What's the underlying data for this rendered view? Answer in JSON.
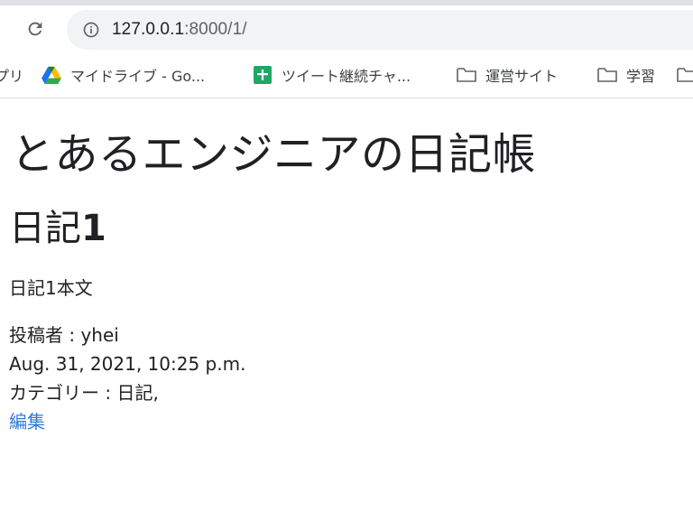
{
  "browser": {
    "url_host": "127.0.0.1",
    "url_path": ":8000/1/",
    "bookmarks": [
      {
        "label": "アプリ",
        "icon": "apps-icon"
      },
      {
        "label": "マイドライブ - Go...",
        "icon": "google-drive-icon"
      },
      {
        "label": "ツイート継続チャ...",
        "icon": "google-sheets-icon"
      },
      {
        "label": "運営サイト",
        "icon": "folder-icon"
      },
      {
        "label": "学習",
        "icon": "folder-icon"
      },
      {
        "label": "",
        "icon": "folder-icon"
      }
    ]
  },
  "page": {
    "site_title": "とあるエンジニアの日記帳",
    "post": {
      "title_text": "日記",
      "title_number": "1",
      "body": "日記1本文",
      "author": "投稿者 : yhei",
      "date": "Aug. 31, 2021, 10:25 p.m.",
      "category": "カテゴリー : 日記,",
      "edit_label": "編集"
    }
  },
  "colors": {
    "link": "#2f7bd6",
    "omnibox_bg": "#f1f3f4"
  }
}
